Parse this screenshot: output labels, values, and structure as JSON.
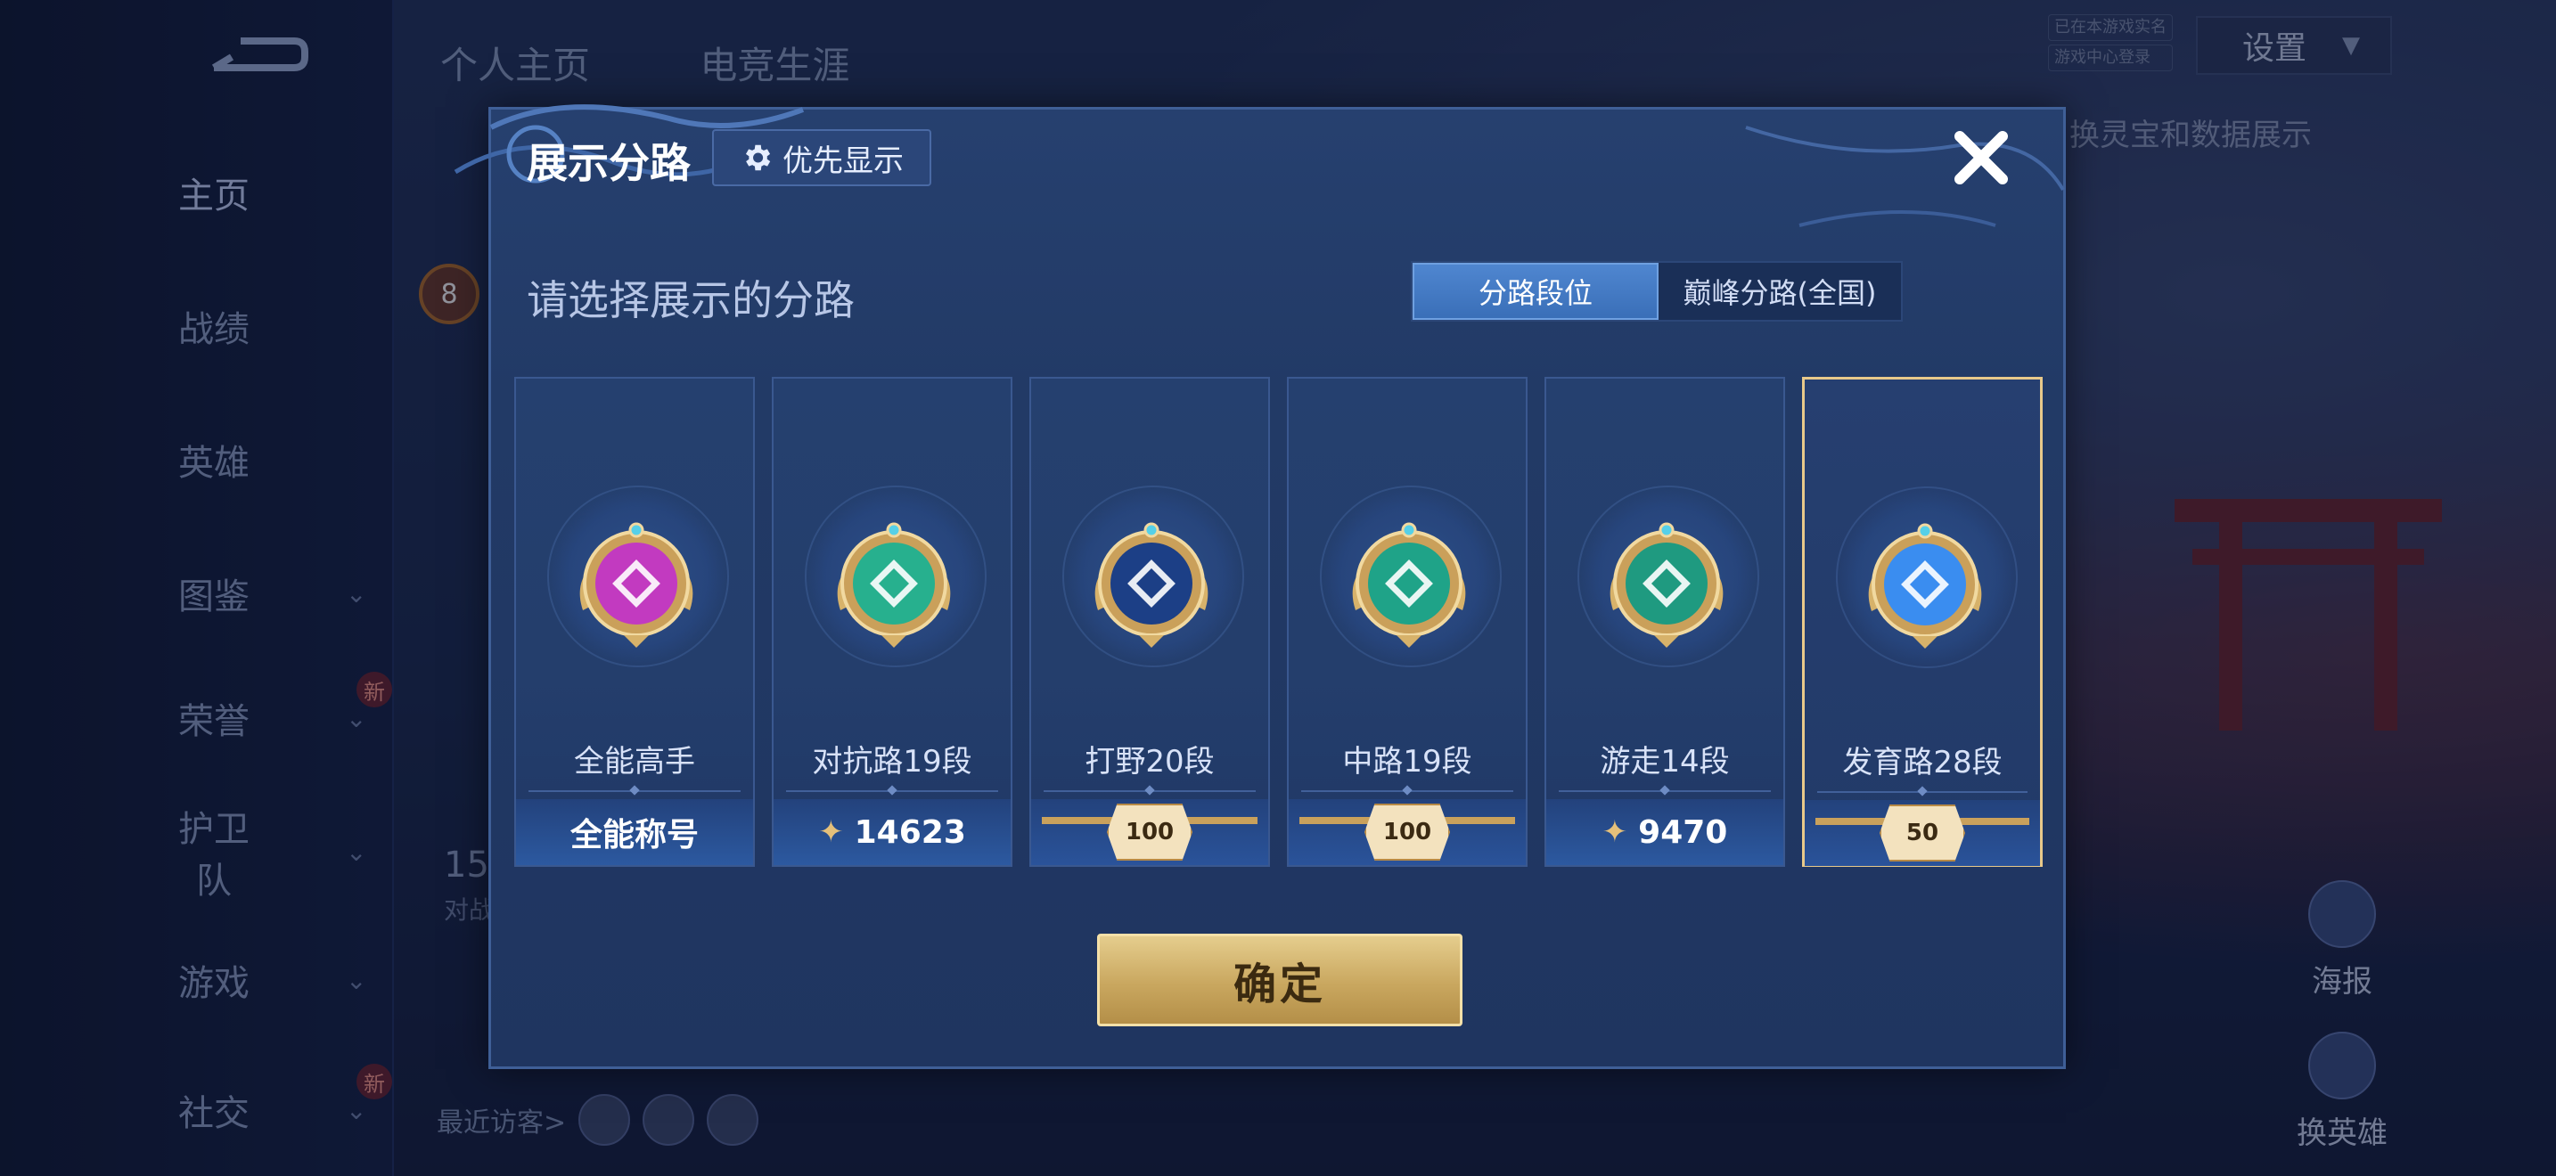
{
  "background": {
    "top_tabs": [
      "个人主页",
      "电竞生涯"
    ],
    "nav": [
      {
        "label": "主页",
        "active": true,
        "chevron": false,
        "new": false
      },
      {
        "label": "战绩",
        "active": false,
        "chevron": false,
        "new": false
      },
      {
        "label": "英雄",
        "active": false,
        "chevron": false,
        "new": false
      },
      {
        "label": "图鉴",
        "active": false,
        "chevron": true,
        "new": false
      },
      {
        "label": "荣誉",
        "active": false,
        "chevron": true,
        "new": true
      },
      {
        "label": "护卫队",
        "active": false,
        "chevron": true,
        "new": false
      },
      {
        "label": "游戏",
        "active": false,
        "chevron": true,
        "new": false
      },
      {
        "label": "社交",
        "active": false,
        "chevron": true,
        "new": true
      }
    ],
    "new_badge": "新",
    "settings_label": "设置",
    "status_tags": [
      "已在本游戏实名",
      "游戏中心登录"
    ],
    "side_hint": "换灵宝和数据展示",
    "poster_label": "海报",
    "swap_hero_label": "换英雄",
    "visitors_label": "最近访客>",
    "level_badge": "8",
    "left_number": "15",
    "left_sub": "对战"
  },
  "modal": {
    "title": "展示分路",
    "priority_label": "优先显示",
    "subtitle": "请选择展示的分路",
    "segments": [
      "分路段位",
      "巅峰分路(全国)"
    ],
    "active_segment": 0,
    "confirm_label": "确定",
    "cards": [
      {
        "name": "全能高手",
        "footer": "全能称号",
        "footer_type": "text",
        "emblem_color": "#c23ac0",
        "selected": false
      },
      {
        "name": "对抗路19段",
        "footer": "14623",
        "footer_type": "points",
        "emblem_color": "#27b08e",
        "selected": false
      },
      {
        "name": "打野20段",
        "footer": "100",
        "footer_type": "badge",
        "emblem_color": "#1c3f86",
        "selected": false
      },
      {
        "name": "中路19段",
        "footer": "100",
        "footer_type": "badge",
        "emblem_color": "#1fa388",
        "selected": false
      },
      {
        "name": "游走14段",
        "footer": "9470",
        "footer_type": "points",
        "emblem_color": "#1f9a80",
        "selected": false
      },
      {
        "name": "发育路28段",
        "footer": "50",
        "footer_type": "badge",
        "emblem_color": "#3a8df0",
        "selected": true
      }
    ]
  }
}
